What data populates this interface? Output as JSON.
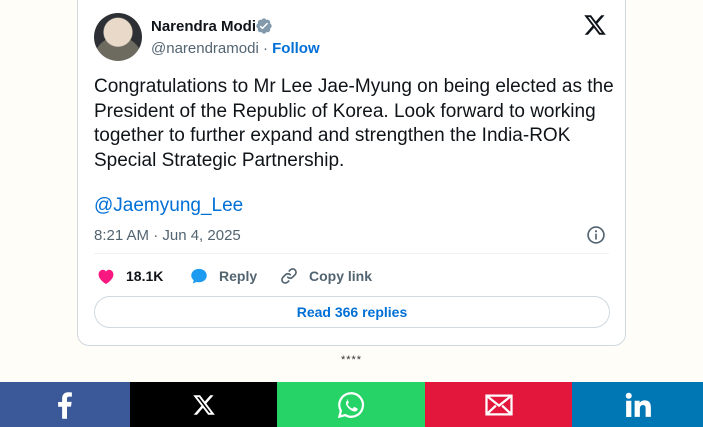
{
  "tweet": {
    "author_name": "Narendra Modi",
    "handle": "@narendramodi",
    "separator_dot": "·",
    "follow_label": "Follow",
    "text": "Congratulations to Mr Lee Jae-Myung on being elected as the President of the Republic of Korea.  Look forward to working together to further expand and strengthen the India-ROK Special Strategic Partnership.",
    "mention": "@Jaemyung_Lee",
    "timestamp": "8:21 AM · Jun 4, 2025",
    "likes": "18.1K",
    "reply_label": "Reply",
    "copy_link_label": "Copy link",
    "read_replies_label": "Read 366 replies"
  },
  "separator": "****",
  "share": {
    "facebook_color": "#3b5998",
    "x_color": "#000000",
    "whatsapp_color": "#25d366",
    "email_color": "#e2173b",
    "linkedin_color": "#0077b5"
  },
  "icons": [
    "verified-badge-icon",
    "x-logo-icon",
    "info-icon",
    "heart-icon",
    "reply-bubble-icon",
    "link-icon",
    "facebook-icon",
    "x-icon",
    "whatsapp-icon",
    "email-icon",
    "linkedin-icon"
  ]
}
